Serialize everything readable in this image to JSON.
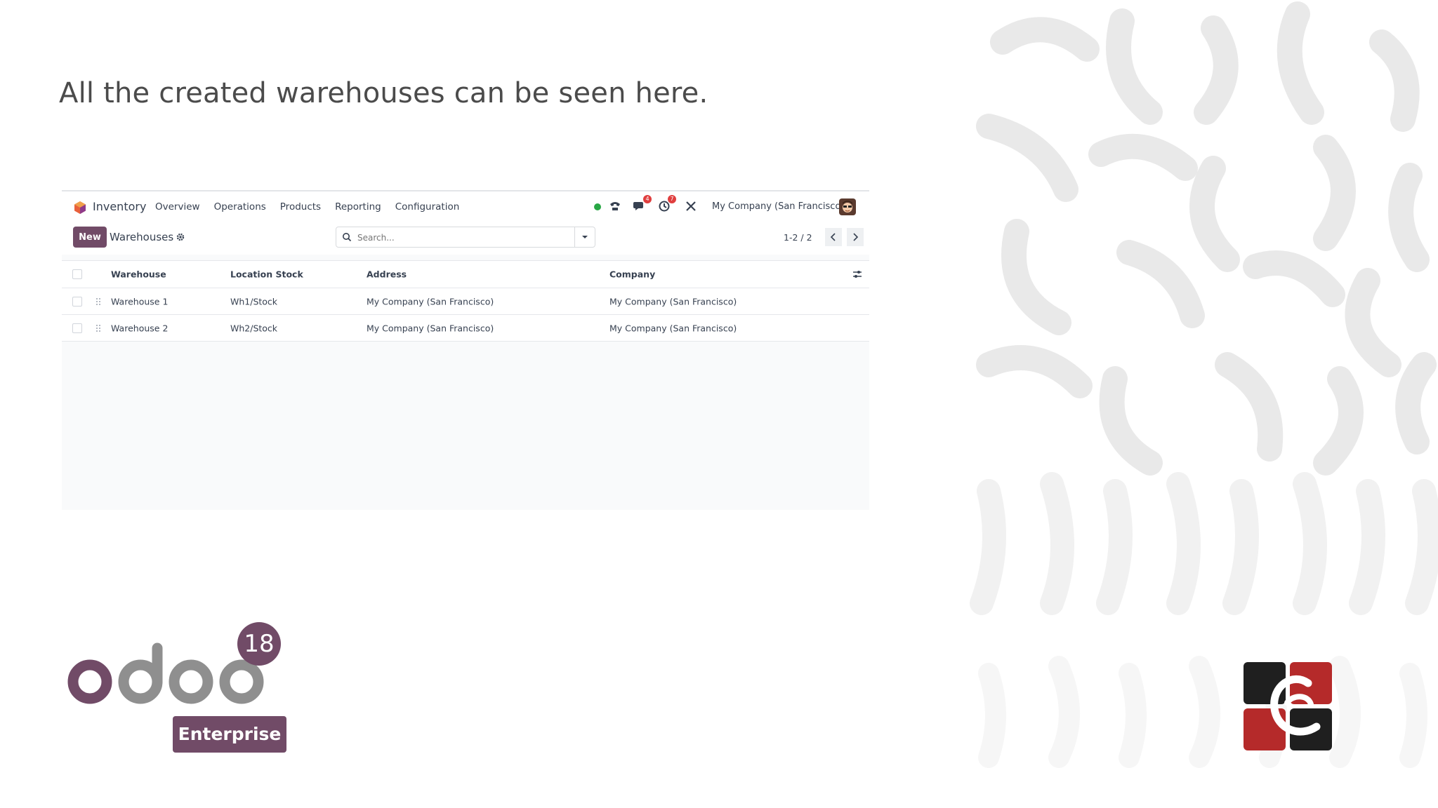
{
  "caption": "All the created warehouses can be seen here.",
  "app": {
    "name": "Inventory",
    "menu": [
      "Overview",
      "Operations",
      "Products",
      "Reporting",
      "Configuration"
    ],
    "status_color": "#28a745",
    "messages_badge": "4",
    "activities_badge": "7",
    "company": "My Company (San Francisco)"
  },
  "control": {
    "new_label": "New",
    "breadcrumb": "Warehouses",
    "search_placeholder": "Search...",
    "pager": "1-2 / 2"
  },
  "table": {
    "headers": [
      "Warehouse",
      "Location Stock",
      "Address",
      "Company"
    ],
    "rows": [
      [
        "Warehouse 1",
        "Wh1/Stock",
        "My Company (San Francisco)",
        "My Company (San Francisco)"
      ],
      [
        "Warehouse 2",
        "Wh2/Stock",
        "My Company (San Francisco)",
        "My Company (San Francisco)"
      ]
    ]
  },
  "branding": {
    "version": "18",
    "edition": "Enterprise",
    "accent": "#714b67"
  }
}
